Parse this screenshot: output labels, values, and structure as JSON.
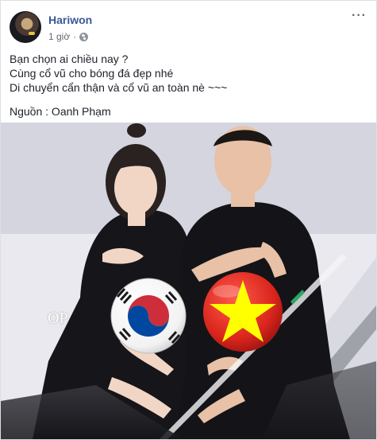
{
  "post": {
    "author": "Hariwon",
    "time": "1 giờ",
    "separator": "·",
    "privacy_icon": "globe-icon",
    "more_icon": "more-options-icon",
    "more_label": "···"
  },
  "body": {
    "lines": [
      "Bạn chọn ai chiều nay ?",
      "Cùng cổ vũ cho bóng đá đẹp nhé",
      "Di chuyển cẩn thận và cổ vũ an toàn nè ~~~"
    ],
    "source": "Nguồn : Oanh Phạm"
  },
  "photo": {
    "watermark": "OP",
    "colors": {
      "korea_red": "#cd2e3a",
      "korea_blue": "#0047a0",
      "vietnam_red": "#da251d",
      "vietnam_star": "#ffff00"
    }
  }
}
